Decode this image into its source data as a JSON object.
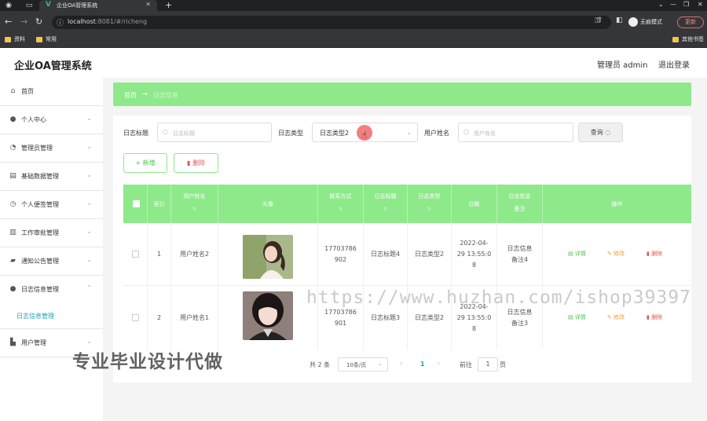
{
  "browser": {
    "tab_title": "企业OA管理系统",
    "url_host": "localhost",
    "url_rest": ":8081/#/richeng",
    "incognito_label": "无痕模式",
    "update_label": "更新",
    "bookmarks": [
      "资料",
      "常用"
    ],
    "bookmark_right": "其他书签"
  },
  "header": {
    "title": "企业OA管理系统",
    "user": "管理员 admin",
    "logout": "退出登录"
  },
  "sidebar": {
    "items": [
      {
        "label": "首页",
        "icon": "home-icon"
      },
      {
        "label": "个人中心",
        "icon": "user-icon"
      },
      {
        "label": "管理员管理",
        "icon": "gauge-icon"
      },
      {
        "label": "基础数据管理",
        "icon": "database-icon"
      },
      {
        "label": "个人便签管理",
        "icon": "clock-icon"
      },
      {
        "label": "工作审批管理",
        "icon": "clipboard-icon"
      },
      {
        "label": "通知公告管理",
        "icon": "megaphone-icon"
      },
      {
        "label": "日志信息管理",
        "icon": "user-icon"
      },
      {
        "label": "用户管理",
        "icon": "chart-icon"
      }
    ],
    "sub_item": "日志信息管理"
  },
  "breadcrumb": {
    "home": "首页",
    "separator": "→",
    "current": "日志信息"
  },
  "search": {
    "title_label": "日志标题",
    "title_placeholder": "日志标题",
    "type_label": "日志类型",
    "type_value": "日志类型2",
    "user_label": "用户姓名",
    "user_placeholder": "用户姓名",
    "query_label": "查询"
  },
  "actions": {
    "add": "+ 新增",
    "delete": "删除"
  },
  "table": {
    "headers": {
      "index": "索引",
      "username": "用户姓名",
      "avatar": "头像",
      "phone": "联系方式",
      "log_title": "日志标题",
      "log_type": "日志类型",
      "date": "日期",
      "note_1": "日志信息",
      "note_2": "备注",
      "ops": "操作"
    },
    "rows": [
      {
        "index": "1",
        "username": "用户姓名2",
        "phone_1": "17703786",
        "phone_2": "902",
        "log_title": "日志标题4",
        "log_type": "日志类型2",
        "date_1": "2022-04-",
        "date_2": "29 13:55:0",
        "date_3": "8",
        "note_1": "日志信息",
        "note_2": "备注4"
      },
      {
        "index": "2",
        "username": "用户姓名1",
        "phone_1": "17703786",
        "phone_2": "901",
        "log_title": "日志标题3",
        "log_type": "日志类型2",
        "date_1": "2022-04-",
        "date_2": "29 13:55:0",
        "date_3": "8",
        "note_1": "日志信息",
        "note_2": "备注3"
      }
    ],
    "op_detail": "详情",
    "op_edit": "修改",
    "op_delete": "删除"
  },
  "pagination": {
    "total": "共 2 条",
    "page_size": "10条/页",
    "current": "1",
    "goto_label": "前往",
    "goto_value": "1",
    "page_suffix": "页"
  },
  "overlays": {
    "watermark": "https://www.huzhan.com/ishop39397",
    "promo": "专业毕业设计代做"
  }
}
